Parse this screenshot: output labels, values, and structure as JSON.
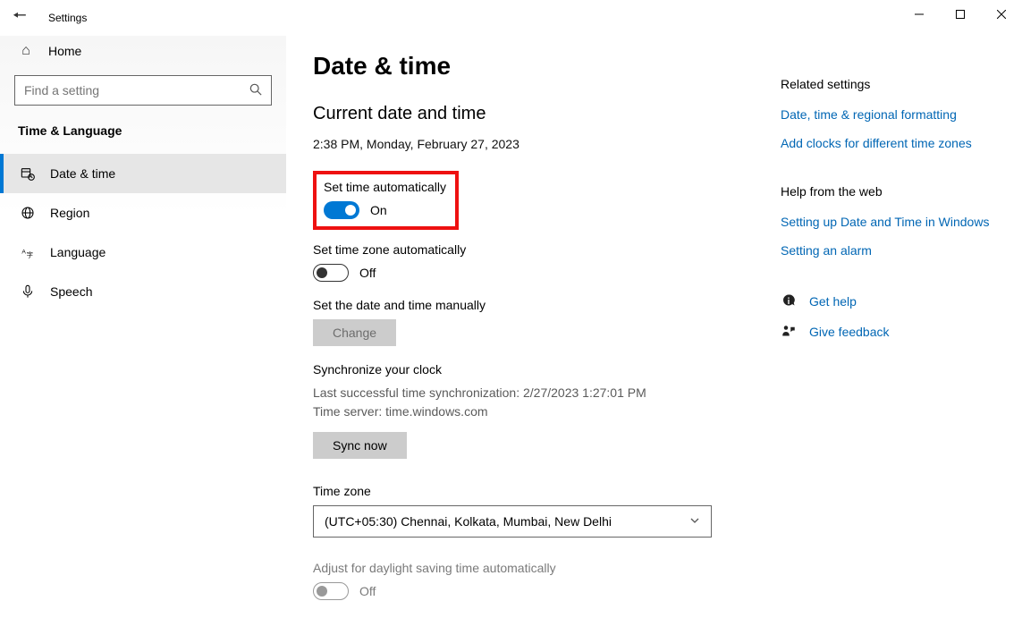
{
  "window": {
    "title": "Settings"
  },
  "sidebar": {
    "home_label": "Home",
    "search_placeholder": "Find a setting",
    "category": "Time & Language",
    "items": [
      {
        "label": "Date & time"
      },
      {
        "label": "Region"
      },
      {
        "label": "Language"
      },
      {
        "label": "Speech"
      }
    ]
  },
  "main": {
    "title": "Date & time",
    "current_heading": "Current date and time",
    "current_value": "2:38 PM, Monday, February 27, 2023",
    "set_time_auto": {
      "label": "Set time automatically",
      "state": "On"
    },
    "set_tz_auto": {
      "label": "Set time zone automatically",
      "state": "Off"
    },
    "manual": {
      "label": "Set the date and time manually",
      "button": "Change"
    },
    "sync": {
      "heading": "Synchronize your clock",
      "last": "Last successful time synchronization: 2/27/2023 1:27:01 PM",
      "server": "Time server: time.windows.com",
      "button": "Sync now"
    },
    "timezone": {
      "label": "Time zone",
      "value": "(UTC+05:30) Chennai, Kolkata, Mumbai, New Delhi"
    },
    "dst": {
      "label": "Adjust for daylight saving time automatically",
      "state": "Off"
    }
  },
  "right": {
    "related_heading": "Related settings",
    "link1": "Date, time & regional formatting",
    "link2": "Add clocks for different time zones",
    "help_heading": "Help from the web",
    "help_link1": "Setting up Date and Time in Windows",
    "help_link2": "Setting an alarm",
    "get_help": "Get help",
    "feedback": "Give feedback"
  }
}
